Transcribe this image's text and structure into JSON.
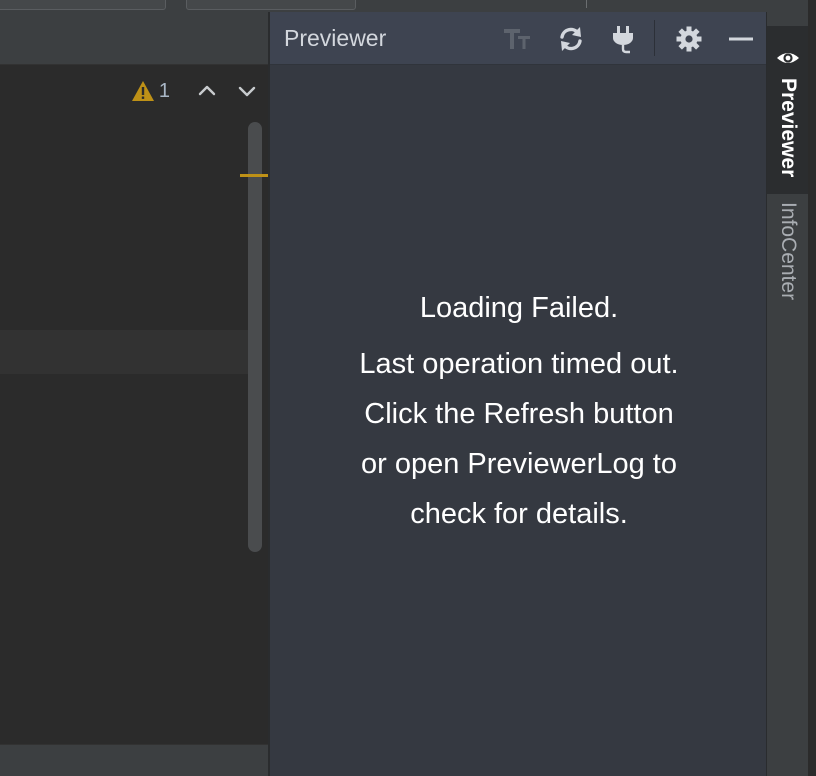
{
  "editor": {
    "inspection": {
      "warning_count": "1",
      "icons": [
        "warning-icon",
        "chevron-up-icon",
        "chevron-down-icon"
      ]
    }
  },
  "previewer": {
    "title": "Previewer",
    "toolbar_icons": [
      "font-size-icon",
      "refresh-icon",
      "plug-icon",
      "gear-icon",
      "minimize-icon"
    ],
    "message": {
      "heading": "Loading Failed.",
      "lines": [
        "Last operation timed out.",
        "Click the Refresh button",
        "or open PreviewerLog to",
        "check for details."
      ]
    }
  },
  "tool_window_strip": {
    "tabs": [
      {
        "label": "Previewer",
        "icon": "eye-icon",
        "active": true
      },
      {
        "label": "InfoCenter",
        "active": false
      }
    ]
  },
  "colors": {
    "warning": "#be9117",
    "panel_bg": "#353941",
    "header_bg": "#3e4451"
  }
}
